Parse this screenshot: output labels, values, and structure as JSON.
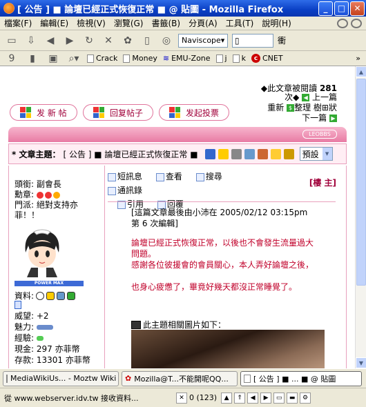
{
  "window": {
    "title": "[ 公告 ] ■ 論壇已經正式恢復正常 ■ @ 貼圖 - Mozilla Firefox"
  },
  "menu": {
    "items": [
      "檔案(F)",
      "編輯(E)",
      "檢視(V)",
      "瀏覽(G)",
      "書籤(B)",
      "分頁(A)",
      "工具(T)",
      "說明(H)"
    ]
  },
  "toolbar": {
    "search_engine": "Naviscope",
    "go_label": "衝"
  },
  "bookmarks": {
    "items": [
      "Crack",
      "Money",
      "EMU-Zone",
      "j",
      "k",
      "CNET"
    ],
    "overflow": "»"
  },
  "page": {
    "read_count_label": "◆此文章被閱讀",
    "read_count": "281",
    "next_label": "次◆",
    "prev_topic": "上一篇",
    "refresh": "重新",
    "organize": "整理",
    "tree": "樹",
    "shape": "狀",
    "next_topic": "下一篇",
    "buttons": [
      "发 新 帖",
      "回复帖子",
      "发起投票"
    ],
    "board_logo": "LEOBBS",
    "subject_label": "* 文章主題：",
    "subject": "[ 公告 ] ■ 論壇已經正式恢復正常 ■",
    "view_select": "預設",
    "user": {
      "title": "頭銜: 副會長",
      "medal": "勳章:",
      "faction": "門派: 絕對支持亦菲！！",
      "power_label": "POWER MAX",
      "info_label": "資料:",
      "prestige": "威望: +2",
      "charm": "魅力:",
      "exp": "經驗:",
      "cash": "現金: 297 亦菲幣",
      "deposit": "存款: 13301 亦菲幣"
    },
    "post_buttons": [
      "短訊息",
      "查看",
      "搜尋",
      "通訊錄",
      "引用",
      "回覆"
    ],
    "floor": "[樓 主]",
    "edit_note": "[這篇文章最後由小沛在 2005/02/12 03:15pm 第 6 次編輯]",
    "body_lines": [
      "論壇已經正式恢復正常，以後也不會發生流量過大問題。",
      "感謝各位彼援會的會員關心，本人弄好論壇之後，",
      "也身心疲憊了，畢竟好幾天都沒正常睡覺了。"
    ],
    "image_intro": "此主題相關圖片如下："
  },
  "tasks": [
    "MediaWikiUs... - Moztw Wiki",
    "Mozilla@T...不能開呢QQ...",
    "[ 公告 ] ■ ... ■ @ 貼圖"
  ],
  "status": {
    "text": "從 www.webserver.idv.tw 接收資料...",
    "counter": "0 (123)"
  }
}
